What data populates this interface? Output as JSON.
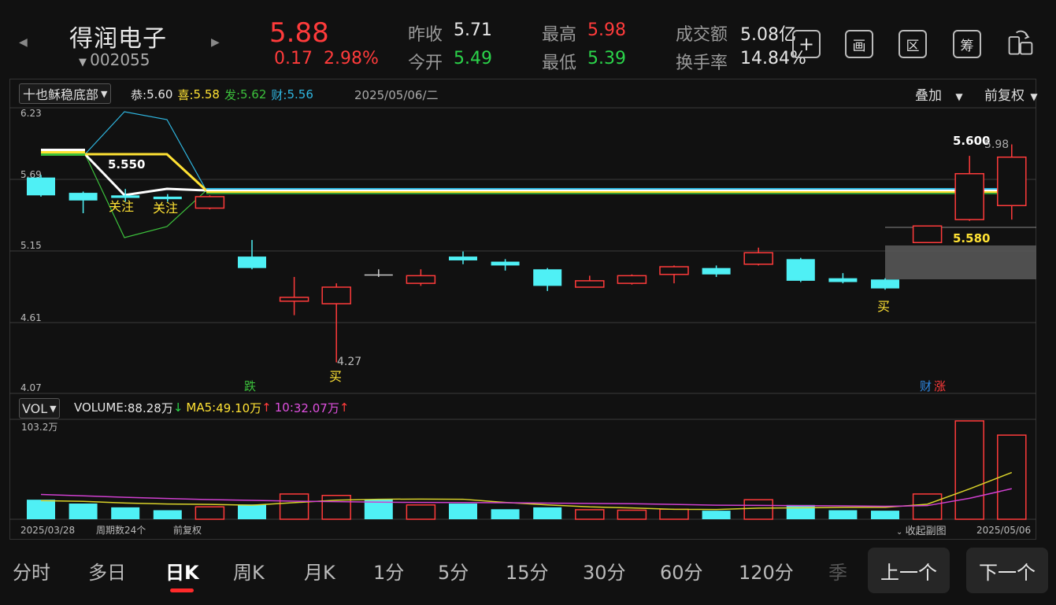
{
  "header": {
    "stock_name": "得润电子",
    "stock_code": "002055",
    "price": "5.88",
    "change": "0.17",
    "change_pct": "2.98%",
    "prev_close_label": "昨收",
    "prev_close": "5.71",
    "open_label": "今开",
    "open": "5.49",
    "high_label": "最高",
    "high": "5.98",
    "low_label": "最低",
    "low": "5.39",
    "turnover_label": "成交额",
    "turnover": "5.08亿",
    "turnover_rate_label": "换手率",
    "turnover_rate": "14.84%",
    "buttons": [
      "+",
      "画",
      "区",
      "筹"
    ]
  },
  "indicator": {
    "name": "十也稣稳底部",
    "gong_label": "恭:",
    "gong": "5.60",
    "xi_label": "喜:",
    "xi": "5.58",
    "fa_label": "发:",
    "fa": "5.62",
    "cai_label": "财:",
    "cai": "5.56",
    "date": "2025/05/06/二",
    "overlay": "叠加",
    "adjust": "前复权"
  },
  "price_axis": [
    "6.23",
    "5.69",
    "5.15",
    "4.61",
    "4.07"
  ],
  "annotations": {
    "guanzhu1": "关注",
    "guanzhu2": "关注",
    "buy1": "买",
    "buy2": "买",
    "low_mark": "4.27",
    "die": "跌",
    "cai": "财",
    "zhang": "涨",
    "label_5550": "5.550",
    "label_5600": "5.600",
    "label_598": "5.98",
    "label_5580": "5.580"
  },
  "volume": {
    "selector": "VOL",
    "vol_label": "VOLUME:",
    "vol": "88.28万",
    "ma5_label": "MA5:",
    "ma5": "49.10万",
    "ma10_label": "10:",
    "ma10": "32.07万",
    "axis_max": "103.2万"
  },
  "footer": {
    "start_date": "2025/03/28",
    "period_count": "周期数24个",
    "adjust": "前复权",
    "collapse": "收起副图",
    "end_date": "2025/05/06"
  },
  "tabs": [
    "分时",
    "多日",
    "日K",
    "周K",
    "月K",
    "1分",
    "5分",
    "15分",
    "30分",
    "60分",
    "120分",
    "季"
  ],
  "nav": {
    "prev": "上一个",
    "next": "下一个"
  },
  "colors": {
    "up": "#ff3b3b",
    "down": "#4ff0f5",
    "bg": "#111111"
  },
  "chart_data": {
    "type": "candlestick",
    "ylim": [
      4.07,
      6.23
    ],
    "candles": [
      {
        "o": 5.72,
        "c": 5.58,
        "h": 5.74,
        "l": 5.57,
        "dir": "down"
      },
      {
        "o": 5.6,
        "c": 5.54,
        "h": 5.61,
        "l": 5.44,
        "dir": "down"
      },
      {
        "o": 5.58,
        "c": 5.56,
        "h": 5.63,
        "l": 5.53,
        "dir": "down"
      },
      {
        "o": 5.57,
        "c": 5.55,
        "h": 5.59,
        "l": 5.53,
        "dir": "down"
      },
      {
        "o": 5.48,
        "c": 5.57,
        "h": 5.58,
        "l": 5.47,
        "dir": "up"
      },
      {
        "o": 5.1,
        "c": 5.01,
        "h": 5.23,
        "l": 5.0,
        "dir": "down"
      },
      {
        "o": 4.75,
        "c": 4.78,
        "h": 4.94,
        "l": 4.64,
        "dir": "up"
      },
      {
        "o": 4.73,
        "c": 4.86,
        "h": 4.89,
        "l": 4.27,
        "dir": "up"
      },
      {
        "o": 4.96,
        "c": 4.96,
        "h": 5.0,
        "l": 4.94,
        "dir": "flat"
      },
      {
        "o": 4.89,
        "c": 4.95,
        "h": 5.0,
        "l": 4.87,
        "dir": "up"
      },
      {
        "o": 5.1,
        "c": 5.07,
        "h": 5.14,
        "l": 5.04,
        "dir": "down"
      },
      {
        "o": 5.06,
        "c": 5.03,
        "h": 5.08,
        "l": 4.99,
        "dir": "down"
      },
      {
        "o": 5.0,
        "c": 4.87,
        "h": 5.01,
        "l": 4.83,
        "dir": "down"
      },
      {
        "o": 4.86,
        "c": 4.91,
        "h": 4.95,
        "l": 4.86,
        "dir": "up"
      },
      {
        "o": 4.89,
        "c": 4.95,
        "h": 4.96,
        "l": 4.88,
        "dir": "up"
      },
      {
        "o": 4.96,
        "c": 5.02,
        "h": 5.03,
        "l": 4.89,
        "dir": "up"
      },
      {
        "o": 5.01,
        "c": 4.96,
        "h": 5.03,
        "l": 4.94,
        "dir": "down"
      },
      {
        "o": 5.04,
        "c": 5.13,
        "h": 5.17,
        "l": 5.03,
        "dir": "up"
      },
      {
        "o": 5.08,
        "c": 4.91,
        "h": 5.09,
        "l": 4.9,
        "dir": "down"
      },
      {
        "o": 4.93,
        "c": 4.9,
        "h": 4.97,
        "l": 4.89,
        "dir": "down"
      },
      {
        "o": 4.92,
        "c": 4.85,
        "h": 4.93,
        "l": 4.84,
        "dir": "down"
      },
      {
        "o": 5.21,
        "c": 5.34,
        "h": 5.34,
        "l": 5.21,
        "dir": "up"
      },
      {
        "o": 5.39,
        "c": 5.75,
        "h": 5.89,
        "l": 5.38,
        "dir": "up"
      },
      {
        "o": 5.5,
        "c": 5.88,
        "h": 5.98,
        "l": 5.39,
        "dir": "up"
      }
    ],
    "volume": {
      "max": 103.2,
      "values": [
        20.5,
        16.5,
        12.5,
        9.5,
        13.0,
        15.5,
        26.5,
        25.0,
        21.0,
        15.0,
        16.5,
        10.5,
        12.5,
        10.0,
        9.5,
        10.5,
        9.0,
        20.5,
        15.0,
        9.5,
        9.0,
        26.5,
        103.2,
        88.28
      ],
      "ma5": [
        19.5,
        18.8,
        17.0,
        16.0,
        15.6,
        14.8,
        17.4,
        20.0,
        21.0,
        21.2,
        21.0,
        17.6,
        15.1,
        13.0,
        11.9,
        10.4,
        10.2,
        11.7,
        12.0,
        12.5,
        12.5,
        15.8,
        31.8,
        49.1
      ],
      "ma10": [
        26.0,
        24.6,
        23.0,
        21.8,
        20.6,
        19.8,
        19.0,
        18.5,
        18.0,
        17.6,
        17.5,
        17.3,
        16.9,
        16.6,
        16.3,
        15.6,
        14.8,
        14.5,
        14.2,
        14.0,
        13.6,
        14.3,
        22.0,
        32.07
      ]
    }
  }
}
